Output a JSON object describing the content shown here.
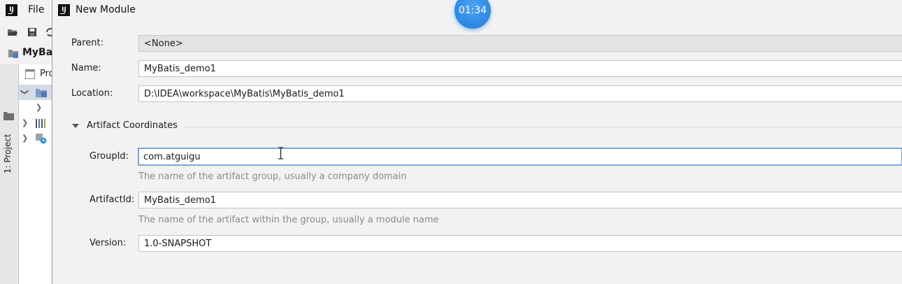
{
  "ide": {
    "menu": {
      "file": "File"
    },
    "toolbar": {
      "icons": [
        "open-folder-icon",
        "save-icon",
        "sync-icon"
      ]
    },
    "navbar": {
      "project_name": "MyBat"
    },
    "tool_window": {
      "tab_label": "1: Project",
      "header_label": "Pro"
    }
  },
  "dialog": {
    "title": "New Module",
    "timer": "01:34",
    "parent": {
      "label": "Parent:",
      "value": "<None>"
    },
    "name": {
      "label": "Name:",
      "value": "MyBatis_demo1"
    },
    "location": {
      "label": "Location:",
      "value": "D:\\IDEA\\workspace\\MyBatis\\MyBatis_demo1"
    },
    "artifact_section": {
      "label": "Artifact Coordinates",
      "group_id": {
        "label": "GroupId:",
        "value": "com.atguigu",
        "hint": "The name of the artifact group, usually a company domain"
      },
      "artifact_id": {
        "label": "ArtifactId:",
        "value": "MyBatis_demo1",
        "hint": "The name of the artifact within the group, usually a module name"
      },
      "version": {
        "label": "Version:",
        "value": "1.0-SNAPSHOT"
      }
    }
  },
  "colors": {
    "dialog_bg": "#f2f2f2",
    "focus_border": "#7aa7d8",
    "timer_blue": "#1d7ee0",
    "hint_text": "#8a8a8a"
  }
}
